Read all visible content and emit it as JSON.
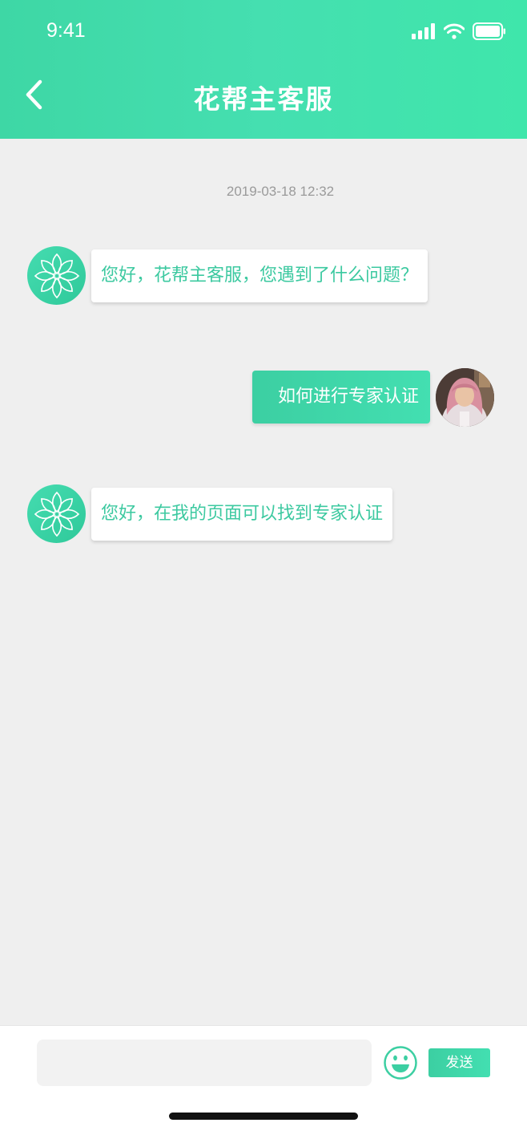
{
  "status_bar": {
    "time": "9:41"
  },
  "header": {
    "title": "花帮主客服"
  },
  "chat": {
    "timestamp": "2019-03-18 12:32",
    "messages": [
      {
        "from": "bot",
        "text": "您好，花帮主客服，您遇到了什么问题？"
      },
      {
        "from": "user",
        "text": "如何进行专家认证"
      },
      {
        "from": "bot",
        "text": "您好，在我的页面可以找到专家认证"
      }
    ]
  },
  "input_bar": {
    "placeholder": "",
    "send_label": "发送"
  },
  "colors": {
    "accent": "#3ed7a5",
    "background": "#efefef"
  }
}
